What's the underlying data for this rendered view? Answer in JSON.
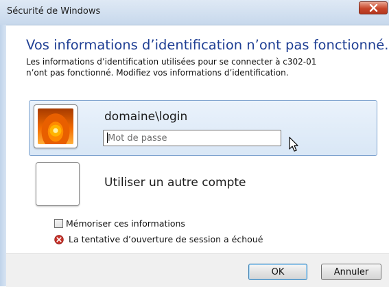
{
  "window": {
    "title": "Sécurité de Windows",
    "close_icon": "close-icon"
  },
  "dialog": {
    "heading": "Vos informations d’identification n’ont pas fonctionné.",
    "description_line1": "Les informations d’identification utilisées pour se connecter à c302-01",
    "description_line2": "n’ont pas fonctionné. Modifiez vos informations d’identification."
  },
  "credential": {
    "username": "domaine\\login",
    "password_placeholder": "Mot de passe",
    "password_value": "",
    "avatar_icon": "flower-avatar-icon"
  },
  "other_account": {
    "label": "Utiliser un autre compte",
    "avatar_icon": "blank-avatar-icon"
  },
  "remember": {
    "label": "Mémoriser ces informations",
    "checked": false
  },
  "error": {
    "message": "La tentative d’ouverture de session a échoué",
    "icon": "error-icon"
  },
  "buttons": {
    "ok": "OK",
    "cancel": "Annuler"
  },
  "colors": {
    "heading": "#1f3f94",
    "selected_tile_border": "#7da2ce",
    "error_red": "#c8322a"
  }
}
